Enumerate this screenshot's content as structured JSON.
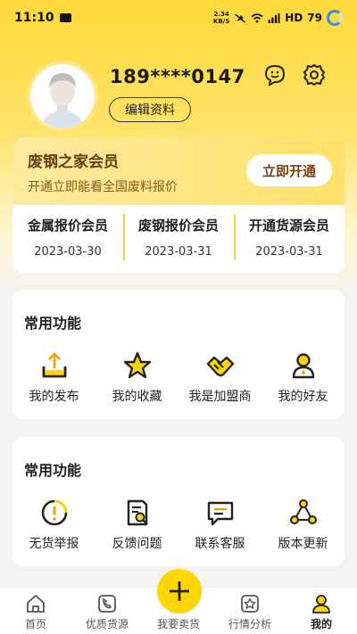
{
  "status": {
    "time": "11:10",
    "net_speed": "2.34",
    "net_unit": "KB/S",
    "hd": "HD",
    "battery": "79"
  },
  "profile": {
    "phone": "189****0147",
    "edit_label": "编辑资料"
  },
  "member": {
    "title": "废钢之家会员",
    "subtitle": "开通立即能看全国废料报价",
    "open_label": "立即开通",
    "columns": [
      {
        "name": "金属报价会员",
        "date": "2023-03-30"
      },
      {
        "name": "废钢报价会员",
        "date": "2023-03-31"
      },
      {
        "name": "开通货源会员",
        "date": "2023-03-31"
      }
    ]
  },
  "functions1": {
    "title": "常用功能",
    "items": [
      {
        "label": "我的发布",
        "icon": "upload-tray-icon"
      },
      {
        "label": "我的收藏",
        "icon": "star-icon"
      },
      {
        "label": "我是加盟商",
        "icon": "handshake-icon"
      },
      {
        "label": "我的好友",
        "icon": "person-icon"
      }
    ]
  },
  "functions2": {
    "title": "常用功能",
    "items": [
      {
        "label": "无货举报",
        "icon": "alert-circle-icon"
      },
      {
        "label": "反馈问题",
        "icon": "document-search-icon"
      },
      {
        "label": "联系客服",
        "icon": "chat-icon"
      },
      {
        "label": "版本更新",
        "icon": "triangle-nodes-icon"
      }
    ]
  },
  "nav": {
    "items": [
      {
        "label": "首页",
        "icon": "home-icon"
      },
      {
        "label": "优质货源",
        "icon": "phone-book-icon"
      },
      {
        "label": "我要卖货",
        "icon": "plus-icon"
      },
      {
        "label": "行情分析",
        "icon": "star-square-icon"
      },
      {
        "label": "我的",
        "icon": "user-icon"
      }
    ]
  },
  "colors": {
    "accent": "#ffd600",
    "member_text": "#6b3c10"
  }
}
